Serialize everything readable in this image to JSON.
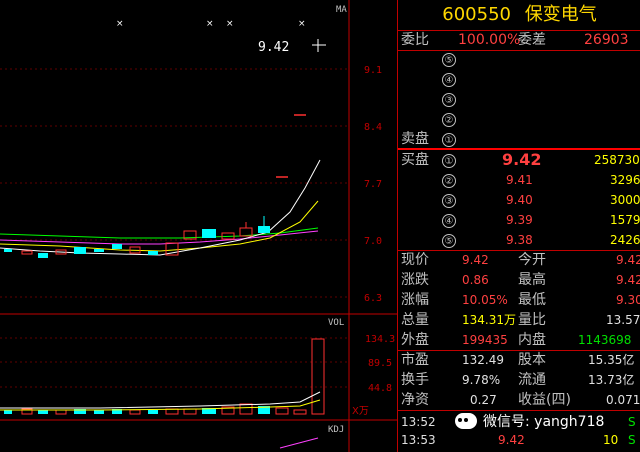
{
  "stock": {
    "code": "600550",
    "name": "保变电气"
  },
  "chart": {
    "ma_label": "MA",
    "current_price_label": "9.42",
    "price_ticks": [
      "9.1",
      "8.4",
      "7.7",
      "7.0",
      "6.3"
    ],
    "vol_label": "VOL",
    "vol_ticks": [
      "134.3",
      "89.5",
      "44.8"
    ],
    "vol_unit": "X万",
    "kdj_label": "KDJ",
    "colors": {
      "up": "#ff3030",
      "down": "#00ffff",
      "ma1": "#ffffff",
      "ma2": "#ffff00",
      "ma3": "#ff40ff",
      "ma4": "#00ff00",
      "grid": "#c00000"
    }
  },
  "panel": {
    "webi": {
      "label": "委比",
      "value": "100.00%",
      "label2": "委差",
      "value2": "26903"
    },
    "sell_label": "卖盘",
    "buy_label": "买盘",
    "sell_levels": [
      "⑤",
      "④",
      "③",
      "②",
      "①"
    ],
    "buy_levels": [
      {
        "n": "①",
        "price": "9.42",
        "vol": "258730"
      },
      {
        "n": "②",
        "price": "9.41",
        "vol": "3296"
      },
      {
        "n": "③",
        "price": "9.40",
        "vol": "3000"
      },
      {
        "n": "④",
        "price": "9.39",
        "vol": "1579"
      },
      {
        "n": "⑤",
        "price": "9.38",
        "vol": "2426"
      }
    ],
    "stats": [
      {
        "l1": "现价",
        "v1": "9.42",
        "c1": "red",
        "l2": "今开",
        "v2": "9.42",
        "c2": "red"
      },
      {
        "l1": "涨跌",
        "v1": "0.86",
        "c1": "red",
        "l2": "最高",
        "v2": "9.42",
        "c2": "red"
      },
      {
        "l1": "涨幅",
        "v1": "10.05%",
        "c1": "red",
        "l2": "最低",
        "v2": "9.30",
        "c2": "red"
      },
      {
        "l1": "总量",
        "v1": "134.31万",
        "c1": "yel",
        "l2": "量比",
        "v2": "13.57",
        "c2": "wht"
      },
      {
        "l1": "外盘",
        "v1": "199435",
        "c1": "red",
        "l2": "内盘",
        "v2": "1143698",
        "c2": "grn"
      },
      {
        "l1": "市盈",
        "v1": "132.49",
        "c1": "wht",
        "l2": "股本",
        "v2": "15.35亿",
        "c2": "wht"
      },
      {
        "l1": "换手",
        "v1": "9.78%",
        "c1": "wht",
        "l2": "流通",
        "v2": "13.73亿",
        "c2": "wht"
      },
      {
        "l1": "净资",
        "v1": "0.27",
        "c1": "wht",
        "l2": "收益(四)",
        "v2": "0.071",
        "c2": "wht"
      }
    ],
    "ticks": [
      {
        "time": "13:52",
        "price": "",
        "vol": "",
        "flag": "S"
      },
      {
        "time": "13:53",
        "price": "9.42",
        "vol": "10",
        "flag": "S"
      }
    ]
  },
  "watermark": {
    "text": "微信号: yangh718"
  }
}
